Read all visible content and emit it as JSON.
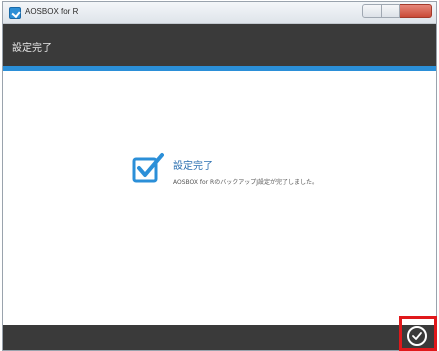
{
  "window": {
    "title": "AOSBOX for R"
  },
  "header": {
    "title": "設定完了"
  },
  "message": {
    "title": "設定完了",
    "body": "AOSBOX for RのバックアップJ設定が完了しました。"
  },
  "colors": {
    "header_bg": "#3a3a3a",
    "accent": "#2b8fd8",
    "title_text": "#2b6fb0",
    "highlight": "#e0181b"
  },
  "icons": {
    "app": "app-logo-icon",
    "status": "checkbox-check-icon",
    "done": "circle-check-icon"
  }
}
